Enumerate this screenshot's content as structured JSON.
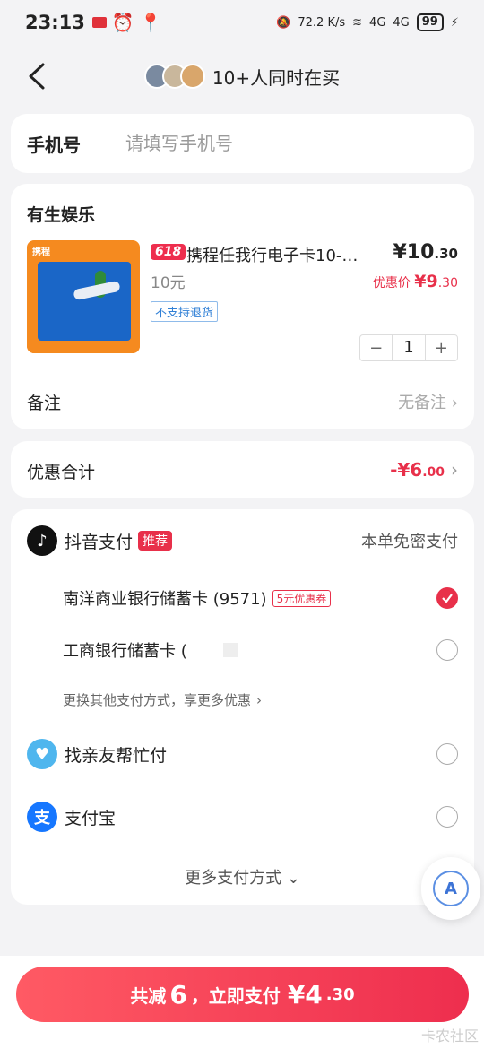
{
  "status_bar": {
    "time": "23:13",
    "speed": "72.2 K/s",
    "net1": "4G",
    "net2": "4G",
    "battery": "99"
  },
  "header": {
    "title": "10+人同时在买",
    "avatar_colors": [
      "#7a8aa0",
      "#c9b79c",
      "#d9a66b"
    ]
  },
  "phone": {
    "label": "手机号",
    "placeholder": "请填写手机号"
  },
  "order": {
    "shop_name": "有生娱乐",
    "promo_tag": "618",
    "product_title": "携程任我行电子卡10-…",
    "price_int": "¥10",
    "price_dec": ".30",
    "spec": "10元",
    "discount_label": "优惠价",
    "discount_int": "¥9",
    "discount_dec": ".30",
    "no_return": "不支持退货",
    "quantity": "1",
    "minus": "−",
    "plus": "+",
    "remark_label": "备注",
    "remark_value": "无备注",
    "thumb_text": "携程"
  },
  "discount_total": {
    "label": "优惠合计",
    "value_int": "-¥6",
    "value_dec": ".00"
  },
  "payment": {
    "douyin": {
      "label": "抖音支付",
      "badge": "推荐",
      "note": "本单免密支付"
    },
    "bank1": {
      "label": "南洋商业银行储蓄卡 (9571)",
      "coupon": "5元优惠券",
      "selected": true
    },
    "bank2": {
      "label": "工商银行储蓄卡 (",
      "selected": false
    },
    "change_method": "更换其他支付方式，享更多优惠",
    "friend": {
      "label": "找亲友帮忙付"
    },
    "alipay": {
      "label": "支付宝",
      "icon_char": "支"
    },
    "more": "更多支付方式"
  },
  "float_button": {
    "label": "A"
  },
  "pay_button": {
    "prefix": "共减",
    "save": "6",
    "mid": "，立即支付",
    "amount_int": "¥4",
    "amount_dec": ".30"
  },
  "watermark": "卡农社区"
}
